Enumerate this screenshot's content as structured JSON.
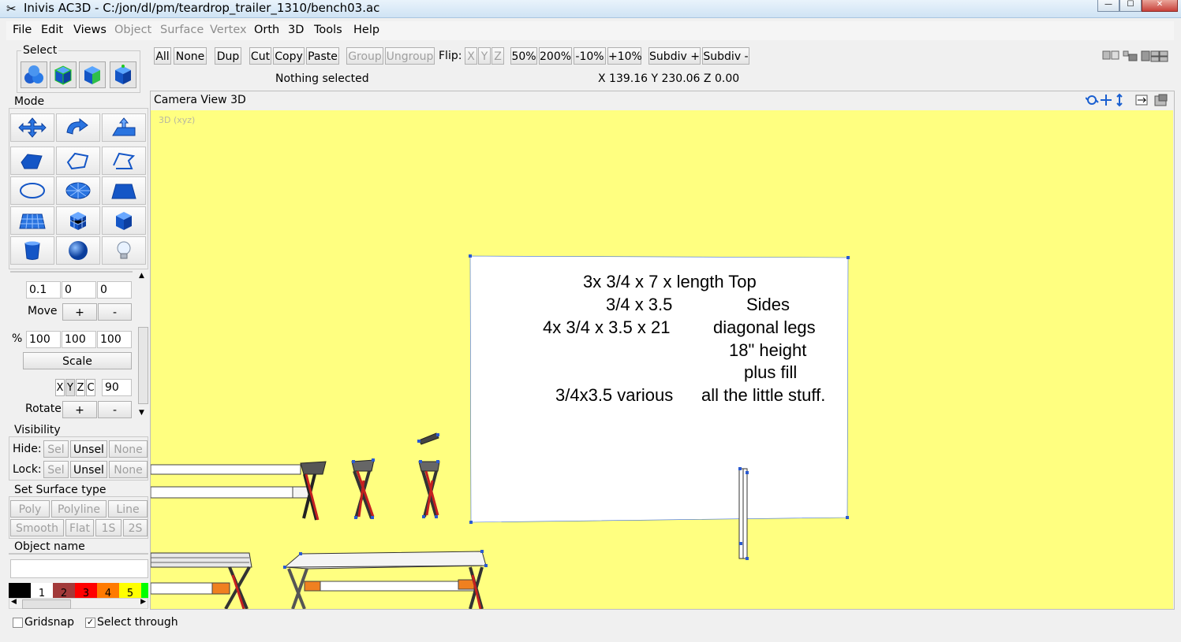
{
  "window": {
    "title": "Inivis AC3D  - C:/jon/dl/pm/teardrop_trailer_1310/bench03.ac",
    "minimize_glyph": "—",
    "maximize_glyph": "☐",
    "close_glyph": "✕"
  },
  "menu": {
    "file": "File",
    "edit": "Edit",
    "views": "Views",
    "object": "Object",
    "surface": "Surface",
    "vertex": "Vertex",
    "orth": "Orth",
    "d3": "3D",
    "tools": "Tools",
    "help": "Help"
  },
  "toolbar": {
    "all": "All",
    "none": "None",
    "dup": "Dup",
    "cut": "Cut",
    "copy": "Copy",
    "paste": "Paste",
    "group": "Group",
    "ungroup": "Ungroup",
    "flip_label": "Flip:",
    "flip_x": "X",
    "flip_y": "Y",
    "flip_z": "Z",
    "zoom50": "50%",
    "zoom200": "200%",
    "minus10": "-10%",
    "plus10": "+10%",
    "subdiv_plus": "Subdiv +",
    "subdiv_minus": "Subdiv -",
    "status": "Nothing selected",
    "coords": "X 139.16 Y 230.06 Z 0.00"
  },
  "select_panel": {
    "title": "Select"
  },
  "mode_panel": {
    "title": "Mode"
  },
  "transform": {
    "move_vals": [
      "0.1",
      "0",
      "0"
    ],
    "move_label": "Move",
    "plus": "+",
    "minus": "-",
    "pct_label": "%",
    "scale_vals": [
      "100",
      "100",
      "100"
    ],
    "scale_label": "Scale",
    "axis_x": "X",
    "axis_y": "Y",
    "axis_z": "Z",
    "axis_c": "C",
    "rotate_val": "90",
    "rotate_label": "Rotate"
  },
  "visibility": {
    "title": "Visibility",
    "hide_label": "Hide:",
    "lock_label": "Lock:",
    "sel": "Sel",
    "unsel": "Unsel",
    "none": "None"
  },
  "surface_type": {
    "title": "Set Surface type",
    "poly": "Poly",
    "polyline": "Polyline",
    "line": "Line",
    "smooth": "Smooth",
    "flat": "Flat",
    "one_s": "1S",
    "two_s": "2S"
  },
  "object_name": {
    "title": "Object name",
    "value": ""
  },
  "palette": {
    "colors": [
      "#000000",
      "#ffffff",
      "#a23a3a",
      "#ff0000",
      "#ff7a00",
      "#ffff00",
      "#00ff00"
    ],
    "labels": [
      "",
      "1",
      "2",
      "3",
      "4",
      "5",
      ""
    ]
  },
  "viewport": {
    "header": "Camera  View  3D",
    "corner_label": "3D (xyz)",
    "sign_lines": [
      "3x  3/4 x 7 x length     Top",
      "3/4 x 3.5",
      "Sides",
      "4x  3/4 x 3.5 x 21",
      "diagonal legs",
      "18\" height",
      "plus fill",
      "3/4x3.5 various",
      "all the little stuff."
    ]
  },
  "status": {
    "gridsnap": "Gridsnap",
    "select_through": "Select through",
    "select_through_mark": "✓"
  }
}
